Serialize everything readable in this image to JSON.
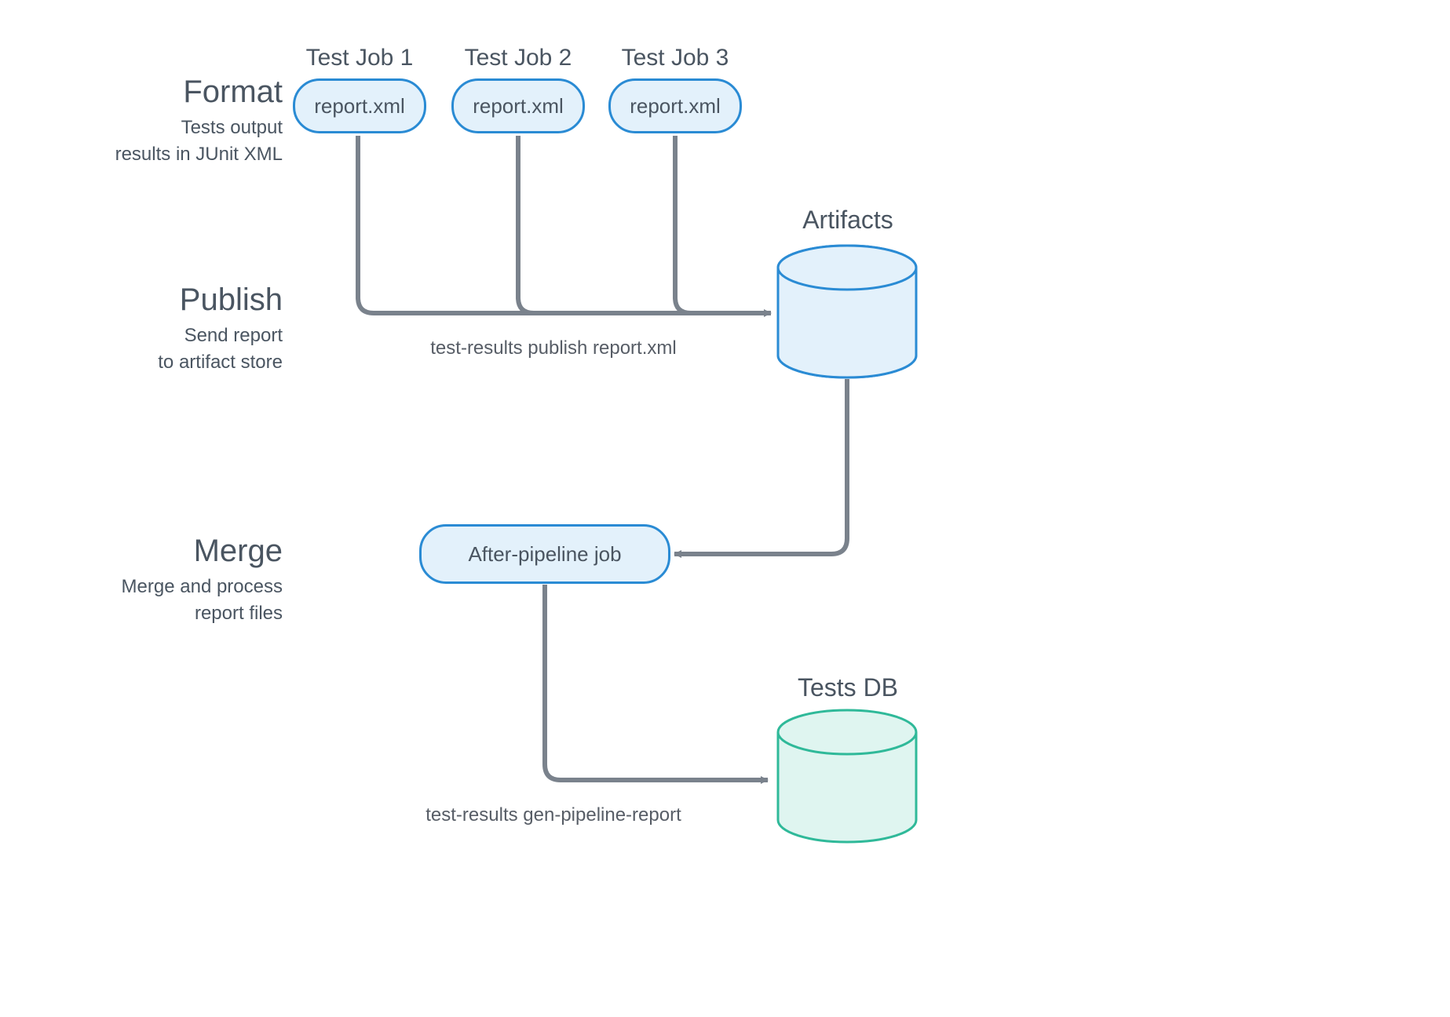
{
  "stages": {
    "format": {
      "title": "Format",
      "sub1": "Tests output",
      "sub2": "results in JUnit XML"
    },
    "publish": {
      "title": "Publish",
      "sub1": "Send report",
      "sub2": "to artifact store"
    },
    "merge": {
      "title": "Merge",
      "sub1": "Merge and process",
      "sub2": "report files"
    }
  },
  "jobs": {
    "job1": {
      "title": "Test Job 1",
      "file": "report.xml"
    },
    "job2": {
      "title": "Test Job 2",
      "file": "report.xml"
    },
    "job3": {
      "title": "Test Job 3",
      "file": "report.xml"
    }
  },
  "afterpipeline": {
    "label": "After-pipeline job"
  },
  "artifacts": {
    "title": "Artifacts"
  },
  "testsdb": {
    "title": "Tests DB"
  },
  "commands": {
    "publish": "test-results publish report.xml",
    "gen": "test-results gen-pipeline-report"
  },
  "colors": {
    "gray": "#7a828c",
    "blueFill": "#e3f1fb",
    "blueStroke": "#2a8bd4",
    "greenFill": "#dff5f0",
    "greenStroke": "#2fb999"
  }
}
